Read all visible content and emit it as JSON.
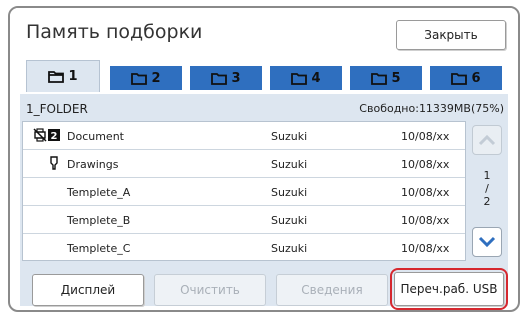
{
  "window": {
    "title": "Память подборки",
    "close_label": "Закрыть"
  },
  "tabs": [
    {
      "label": "1",
      "active": true
    },
    {
      "label": "2",
      "active": false
    },
    {
      "label": "3",
      "active": false
    },
    {
      "label": "4",
      "active": false
    },
    {
      "label": "5",
      "active": false
    },
    {
      "label": "6",
      "active": false
    }
  ],
  "folder": {
    "name": "1_FOLDER",
    "free_space": "Свободно:11339MB(75%)"
  },
  "files": [
    {
      "icon_lock": "no-print-icon",
      "icon_badge": "2",
      "name": "Document",
      "owner": "Suzuki",
      "date": "10/08/xx"
    },
    {
      "icon_lock": "",
      "icon_badge": "pin-icon",
      "name": "Drawings",
      "owner": "Suzuki",
      "date": "10/08/xx"
    },
    {
      "icon_lock": "",
      "icon_badge": "",
      "name": "Templete_A",
      "owner": "Suzuki",
      "date": "10/08/xx"
    },
    {
      "icon_lock": "",
      "icon_badge": "",
      "name": "Templete_B",
      "owner": "Suzuki",
      "date": "10/08/xx"
    },
    {
      "icon_lock": "",
      "icon_badge": "",
      "name": "Templete_C",
      "owner": "Suzuki",
      "date": "10/08/xx"
    }
  ],
  "pager": {
    "current": "1",
    "separator": "/",
    "total": "2"
  },
  "buttons": {
    "display": "Дисплей",
    "clear": "Очистить",
    "info": "Сведения",
    "usb": "Переч.раб. USB"
  },
  "colors": {
    "tab_fill": "#2f6fbf",
    "panel_bg": "#dde6f0",
    "highlight": "#d6282f",
    "scroll_arrow": "#2f6fbf"
  }
}
